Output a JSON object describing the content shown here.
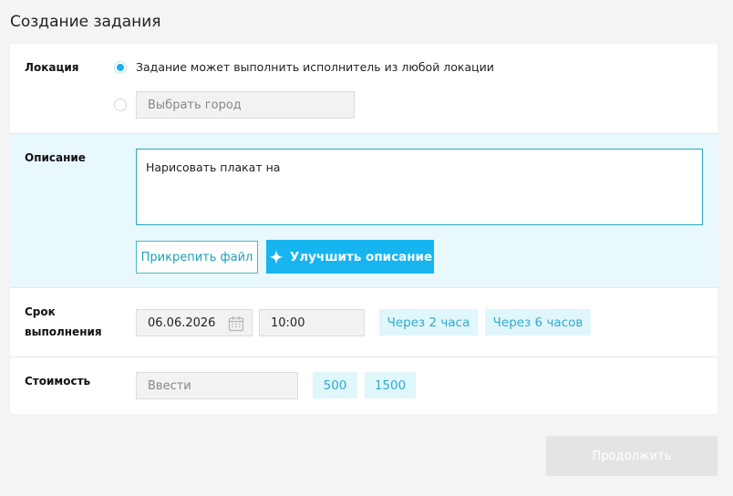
{
  "page": {
    "title": "Создание задания"
  },
  "location": {
    "label": "Локация",
    "option_any": "Задание может выполнить исполнитель из любой локации",
    "city_placeholder": "Выбрать город"
  },
  "description": {
    "label": "Описание",
    "text": "Нарисовать плакат на",
    "attach_button": "Прикрепить файл",
    "improve_button": "Улучшить описание"
  },
  "term": {
    "label_line1": "Срок",
    "label_line2": "выполнения",
    "date": "06.06.2026",
    "time": "10:00",
    "quick_1": "Через 2 часа",
    "quick_2": "Через 6 часов"
  },
  "cost": {
    "label": "Стоимость",
    "placeholder": "Ввести",
    "quick_1": "500",
    "quick_2": "1500"
  },
  "actions": {
    "continue": "Продолжить"
  },
  "colors": {
    "accent": "#16b5ef",
    "teal": "#27a8ba",
    "section_bg": "#e8f8fd"
  }
}
